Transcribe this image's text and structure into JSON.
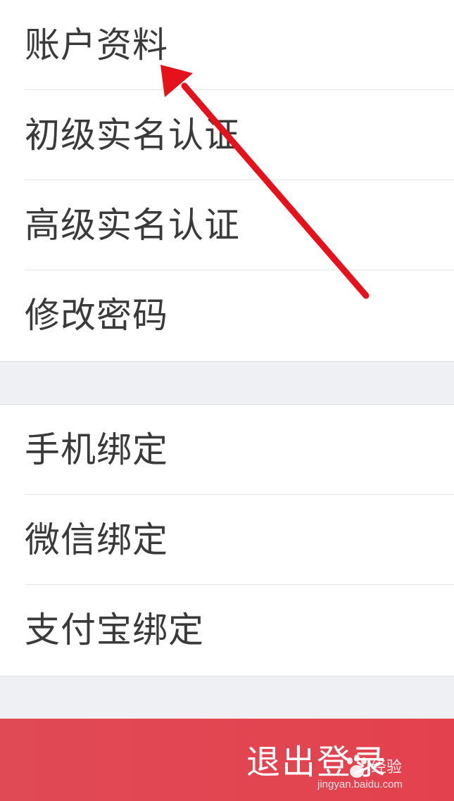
{
  "menu_group_1": [
    {
      "label": "账户资料"
    },
    {
      "label": "初级实名认证"
    },
    {
      "label": "高级实名认证"
    },
    {
      "label": "修改密码"
    }
  ],
  "menu_group_2": [
    {
      "label": "手机绑定"
    },
    {
      "label": "微信绑定"
    },
    {
      "label": "支付宝绑定"
    }
  ],
  "logout": {
    "label": "退出登录"
  },
  "watermark": {
    "brand": "经验",
    "url": "jingyan.baidu.com"
  },
  "colors": {
    "logout_bg": "#e3414d",
    "arrow": "#e5121b",
    "separator": "#eef0f3"
  },
  "annotation": {
    "icon": "red-arrow-icon"
  }
}
